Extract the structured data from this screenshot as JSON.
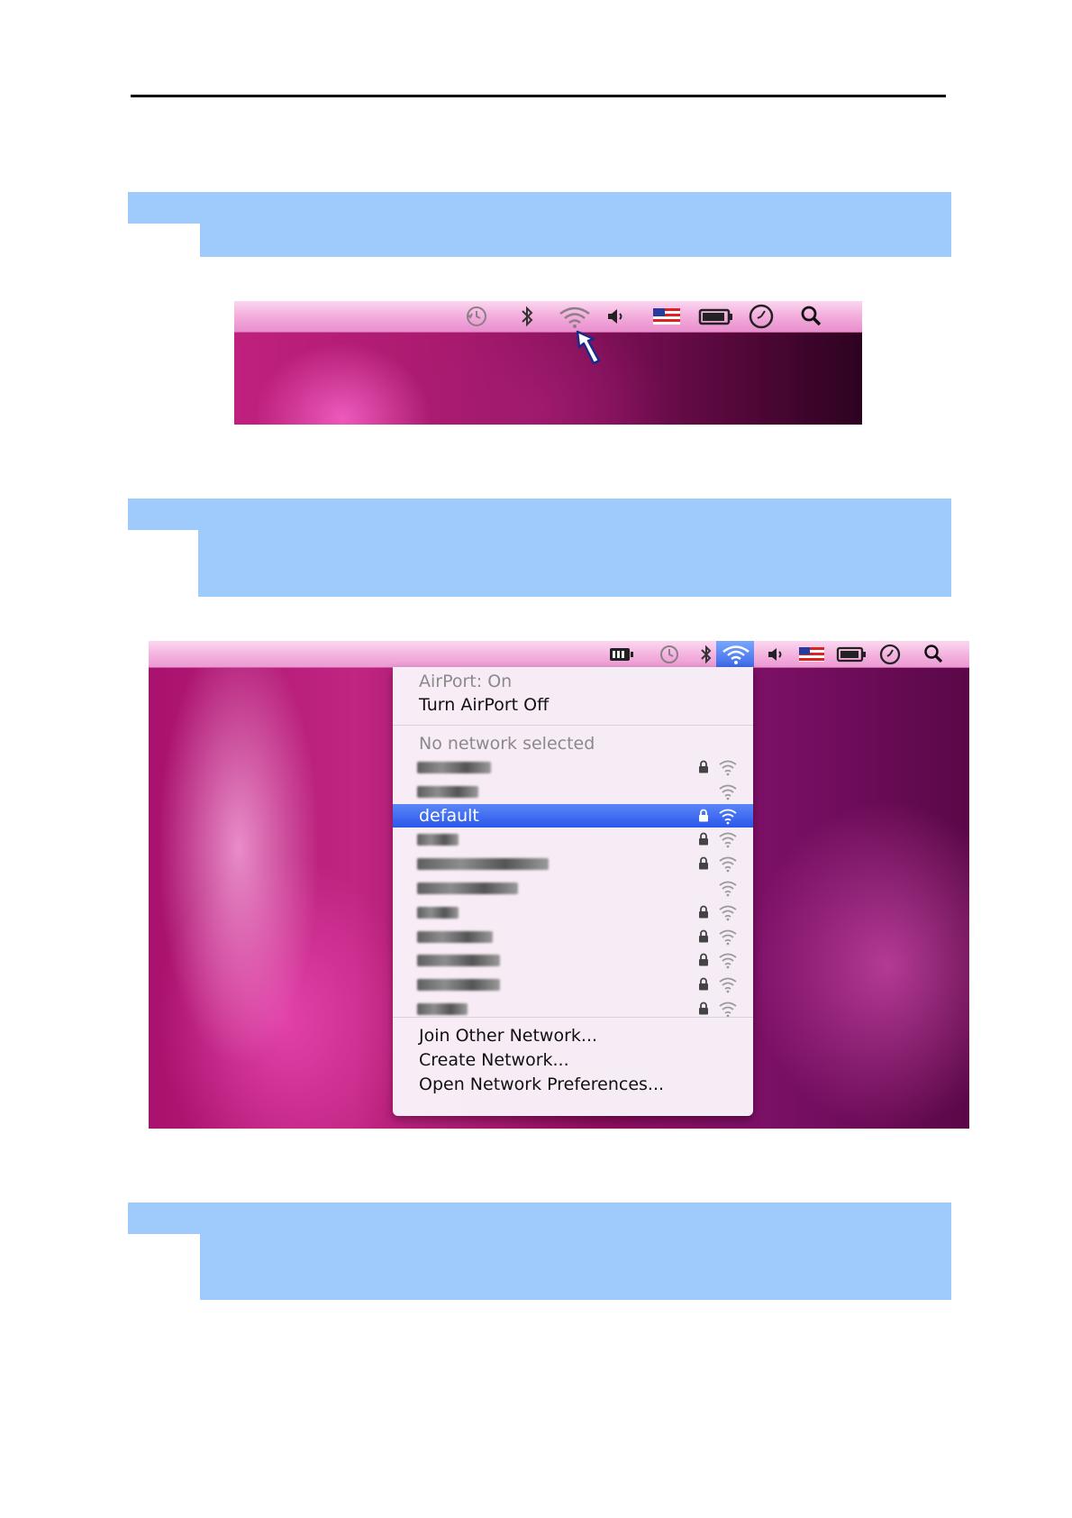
{
  "menu": {
    "airport_status": "AirPort: On",
    "turn_off": "Turn AirPort Off",
    "no_network": "No network selected",
    "networks": [
      {
        "name": "",
        "selected": false,
        "locked": true,
        "blur_width": 82
      },
      {
        "name": "",
        "selected": false,
        "locked": false,
        "blur_width": 68
      },
      {
        "name": "default",
        "selected": true,
        "locked": true,
        "blur_width": 0
      },
      {
        "name": "",
        "selected": false,
        "locked": true,
        "blur_width": 46
      },
      {
        "name": "",
        "selected": false,
        "locked": true,
        "blur_width": 146
      },
      {
        "name": "",
        "selected": false,
        "locked": false,
        "blur_width": 112
      },
      {
        "name": "",
        "selected": false,
        "locked": true,
        "blur_width": 46
      },
      {
        "name": "",
        "selected": false,
        "locked": true,
        "blur_width": 84
      },
      {
        "name": "",
        "selected": false,
        "locked": true,
        "blur_width": 92
      },
      {
        "name": "",
        "selected": false,
        "locked": true,
        "blur_width": 92
      },
      {
        "name": "",
        "selected": false,
        "locked": true,
        "blur_width": 56
      }
    ],
    "join_other": "Join Other Network...",
    "create": "Create Network...",
    "open_prefs": "Open Network Preferences..."
  },
  "menubar_icons": [
    "battery-icon",
    "time-machine-icon",
    "bluetooth-icon",
    "wifi-icon",
    "volume-icon",
    "us-flag-input-icon",
    "battery-status-icon",
    "clock-icon",
    "spotlight-search-icon"
  ],
  "colors": {
    "instruction_block": "#9ecbfb",
    "selection_top": "#5b86f8",
    "selection_bottom": "#2a57ea"
  }
}
